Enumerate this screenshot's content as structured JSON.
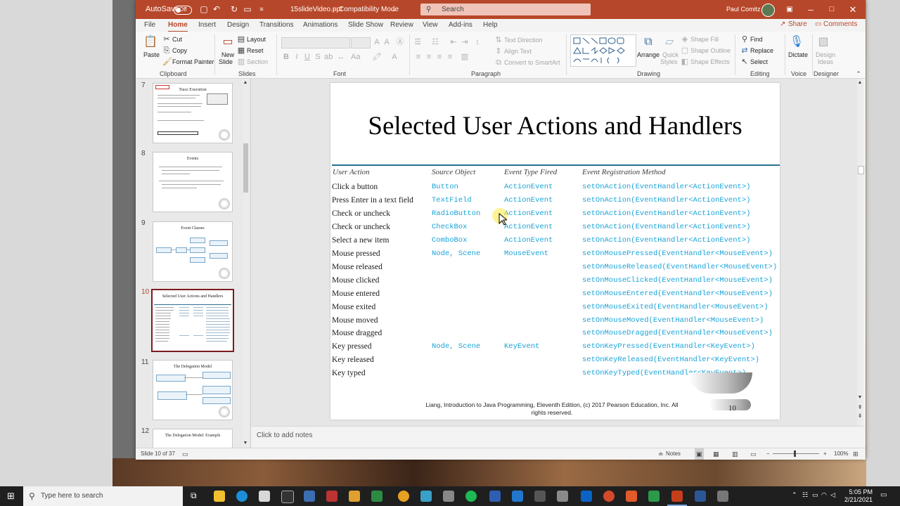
{
  "titlebar": {
    "autosave_label": "AutoSave",
    "autosave_state": "Off",
    "filename": "15slideVideo.ppt",
    "separator": "-",
    "mode": "Compatibility Mode",
    "search_placeholder": "Search",
    "user_name": "Paul Comitz"
  },
  "tabs": [
    "File",
    "Home",
    "Insert",
    "Design",
    "Transitions",
    "Animations",
    "Slide Show",
    "Review",
    "View",
    "Add-ins",
    "Help"
  ],
  "share_label": "Share",
  "comments_label": "Comments",
  "ribbon": {
    "clipboard": {
      "paste": "Paste",
      "cut": "Cut",
      "copy": "Copy",
      "format_painter": "Format Painter",
      "group": "Clipboard"
    },
    "slides": {
      "new_slide": "New",
      "new_slide2": "Slide",
      "layout": "Layout",
      "reset": "Reset",
      "section": "Section",
      "group": "Slides"
    },
    "font": {
      "group": "Font"
    },
    "paragraph": {
      "text_direction": "Text Direction",
      "align_text": "Align Text",
      "convert_smartart": "Convert to SmartArt",
      "group": "Paragraph"
    },
    "drawing": {
      "arrange": "Arrange",
      "quick_styles": "Quick",
      "quick_styles2": "Styles",
      "shape_fill": "Shape Fill",
      "shape_outline": "Shape Outline",
      "shape_effects": "Shape Effects",
      "group": "Drawing"
    },
    "editing": {
      "find": "Find",
      "replace": "Replace",
      "select": "Select",
      "group": "Editing"
    },
    "voice": {
      "dictate": "Dictate",
      "group": "Voice"
    },
    "designer": {
      "design_ideas": "Design",
      "design_ideas2": "Ideas",
      "group": "Designer"
    }
  },
  "thumbnails": [
    {
      "num": "7",
      "title": "Trace Execution"
    },
    {
      "num": "8",
      "title": "Events"
    },
    {
      "num": "9",
      "title": "Event Classes"
    },
    {
      "num": "10",
      "title": "Selected User Actions and Handlers"
    },
    {
      "num": "11",
      "title": "The Delegation Model"
    },
    {
      "num": "12",
      "title": "The Delegation Model: Example"
    }
  ],
  "slide": {
    "title": "Selected User Actions and Handlers",
    "headers": [
      "User Action",
      "Source Object",
      "Event Type Fired",
      "Event Registration Method"
    ],
    "rows": [
      [
        "Click a button",
        "Button",
        "ActionEvent",
        "setOnAction(EventHandler<ActionEvent>)"
      ],
      [
        "Press Enter in a text field",
        "TextField",
        "ActionEvent",
        "setOnAction(EventHandler<ActionEvent>)"
      ],
      [
        "Check or uncheck",
        "RadioButton",
        "ActionEvent",
        "setOnAction(EventHandler<ActionEvent>)"
      ],
      [
        "Check or uncheck",
        "CheckBox",
        "ActionEvent",
        "setOnAction(EventHandler<ActionEvent>)"
      ],
      [
        "Select a new item",
        "ComboBox",
        "ActionEvent",
        "setOnAction(EventHandler<ActionEvent>)"
      ],
      [
        "Mouse pressed",
        "Node, Scene",
        "MouseEvent",
        "setOnMousePressed(EventHandler<MouseEvent>)"
      ],
      [
        "Mouse released",
        "",
        "",
        "setOnMouseReleased(EventHandler<MouseEvent>)"
      ],
      [
        "Mouse clicked",
        "",
        "",
        "setOnMouseClicked(EventHandler<MouseEvent>)"
      ],
      [
        "Mouse entered",
        "",
        "",
        "setOnMouseEntered(EventHandler<MouseEvent>)"
      ],
      [
        "Mouse exited",
        "",
        "",
        "setOnMouseExited(EventHandler<MouseEvent>)"
      ],
      [
        "Mouse moved",
        "",
        "",
        "setOnMouseMoved(EventHandler<MouseEvent>)"
      ],
      [
        "Mouse dragged",
        "",
        "",
        "setOnMouseDragged(EventHandler<MouseEvent>)"
      ],
      [
        "Key pressed",
        "Node, Scene",
        "KeyEvent",
        "setOnKeyPressed(EventHandler<KeyEvent>)"
      ],
      [
        "Key released",
        "",
        "",
        "setOnKeyReleased(EventHandler<KeyEvent>)"
      ],
      [
        "Key typed",
        "",
        "",
        "setOnKeyTyped(EventHandler<KeyEvent>)"
      ]
    ],
    "footer_line1": "Liang, Introduction to Java Programming, Eleventh Edition, (c) 2017 Pearson Education, Inc. All",
    "footer_line2": "rights reserved.",
    "page_number": "10"
  },
  "notes_placeholder": "Click to add notes",
  "status": {
    "slide_info": "Slide 10 of 37",
    "notes": "Notes",
    "zoom": "100%"
  },
  "taskbar": {
    "search_placeholder": "Type here to search",
    "time": "5:05 PM",
    "date": "2/21/2021"
  },
  "colors": {
    "accent": "#b7472a",
    "code_blue": "#1aa3d8",
    "selected_border": "#7b1c21"
  }
}
